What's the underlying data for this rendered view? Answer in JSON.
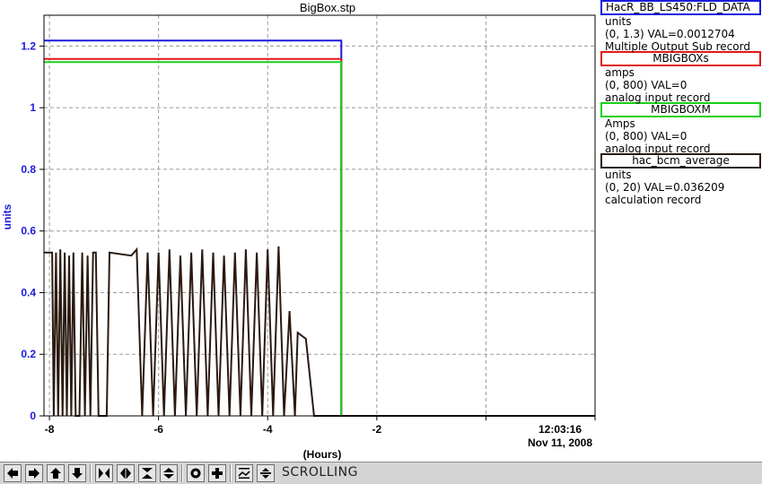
{
  "chart_data": {
    "type": "line",
    "title": "BigBox.stp",
    "ylabel": "units",
    "xlabel": "(Hours)",
    "xlim": [
      -8.1,
      2.0
    ],
    "ylim": [
      0,
      1.3
    ],
    "x_ticks": [
      "-8",
      "-6",
      "-4",
      "-2"
    ],
    "x_tick_values": [
      -8,
      -6,
      -4,
      -2
    ],
    "y_ticks": [
      "0",
      "0.2",
      "0.4",
      "0.6",
      "0.8",
      "1",
      "1.2"
    ],
    "y_tick_values": [
      0,
      0.2,
      0.4,
      0.6,
      0.8,
      1.0,
      1.2
    ],
    "grid": true,
    "timestamp": {
      "time": "12:03:16",
      "date": "Nov 11, 2008"
    },
    "series": [
      {
        "name": "HacR_BB_LS450:FLD_DATA",
        "color": "#1a1adc",
        "points": [
          [
            -8.1,
            1.218
          ],
          [
            -2.65,
            1.218
          ],
          [
            -2.65,
            0.0
          ],
          [
            2.0,
            0.0
          ]
        ]
      },
      {
        "name": "MBIGBOXs",
        "color": "#e01818",
        "points": [
          [
            -8.1,
            1.158
          ],
          [
            -2.65,
            1.158
          ],
          [
            -2.65,
            0.0
          ],
          [
            2.0,
            0.0
          ]
        ]
      },
      {
        "name": "MBIGBOXM",
        "color": "#18d018",
        "points": [
          [
            -8.1,
            1.148
          ],
          [
            -2.65,
            1.148
          ],
          [
            -2.65,
            0.0
          ],
          [
            2.0,
            0.0
          ]
        ]
      },
      {
        "name": "hac_bcm_average",
        "color": "#2a1a10",
        "points": [
          [
            -8.1,
            0.53
          ],
          [
            -7.95,
            0.53
          ],
          [
            -7.92,
            0.0
          ],
          [
            -7.88,
            0.53
          ],
          [
            -7.84,
            0.0
          ],
          [
            -7.8,
            0.54
          ],
          [
            -7.76,
            0.0
          ],
          [
            -7.72,
            0.53
          ],
          [
            -7.68,
            0.0
          ],
          [
            -7.64,
            0.52
          ],
          [
            -7.6,
            0.0
          ],
          [
            -7.56,
            0.53
          ],
          [
            -7.52,
            0.0
          ],
          [
            -7.45,
            0.0
          ],
          [
            -7.4,
            0.53
          ],
          [
            -7.35,
            0.0
          ],
          [
            -7.3,
            0.52
          ],
          [
            -7.25,
            0.0
          ],
          [
            -7.2,
            0.53
          ],
          [
            -7.15,
            0.53
          ],
          [
            -7.1,
            0.0
          ],
          [
            -6.95,
            0.0
          ],
          [
            -6.9,
            0.53
          ],
          [
            -6.5,
            0.52
          ],
          [
            -6.4,
            0.54
          ],
          [
            -6.3,
            0.0
          ],
          [
            -6.2,
            0.53
          ],
          [
            -6.1,
            0.0
          ],
          [
            -6.0,
            0.53
          ],
          [
            -5.9,
            0.0
          ],
          [
            -5.8,
            0.54
          ],
          [
            -5.7,
            0.0
          ],
          [
            -5.6,
            0.52
          ],
          [
            -5.5,
            0.0
          ],
          [
            -5.4,
            0.53
          ],
          [
            -5.3,
            0.0
          ],
          [
            -5.2,
            0.54
          ],
          [
            -5.1,
            0.0
          ],
          [
            -5.0,
            0.53
          ],
          [
            -4.9,
            0.0
          ],
          [
            -4.8,
            0.52
          ],
          [
            -4.7,
            0.0
          ],
          [
            -4.6,
            0.53
          ],
          [
            -4.5,
            0.0
          ],
          [
            -4.4,
            0.54
          ],
          [
            -4.3,
            0.0
          ],
          [
            -4.2,
            0.53
          ],
          [
            -4.1,
            0.0
          ],
          [
            -4.0,
            0.54
          ],
          [
            -3.9,
            0.0
          ],
          [
            -3.8,
            0.55
          ],
          [
            -3.7,
            0.0
          ],
          [
            -3.6,
            0.34
          ],
          [
            -3.5,
            0.0
          ],
          [
            -3.45,
            0.27
          ],
          [
            -3.3,
            0.25
          ],
          [
            -3.15,
            0.0
          ],
          [
            -2.65,
            0.0
          ],
          [
            -2.65,
            0.0
          ],
          [
            2.0,
            0.0
          ]
        ]
      }
    ]
  },
  "legend": [
    {
      "name": "HacR_BB_LS450:FLD_DATA",
      "color": "#1a1adc",
      "units": "units",
      "value": "(0, 1.3) VAL=0.0012704",
      "record": "Multiple Output Sub record"
    },
    {
      "name": "MBIGBOXs",
      "color": "#e01818",
      "units": "amps",
      "value": "(0, 800) VAL=0",
      "record": "analog input record"
    },
    {
      "name": "MBIGBOXM",
      "color": "#18d018",
      "units": "Amps",
      "value": "(0, 800) VAL=0",
      "record": "analog input record"
    },
    {
      "name": "hac_bcm_average",
      "color": "#2a1a10",
      "units": "units",
      "value": "(0, 20) VAL=0.036209",
      "record": "calculation record"
    }
  ],
  "toolbar": {
    "mode_label": "SCROLLING",
    "buttons": [
      "scroll-left-icon",
      "scroll-right-icon",
      "scroll-up-icon",
      "scroll-down-icon",
      "zoom-in-horizontal-icon",
      "zoom-out-horizontal-icon",
      "zoom-in-vertical-icon",
      "zoom-out-vertical-icon",
      "zoom-reset-icon",
      "plus-icon",
      "autoscale-icon",
      "scale-icon"
    ]
  }
}
